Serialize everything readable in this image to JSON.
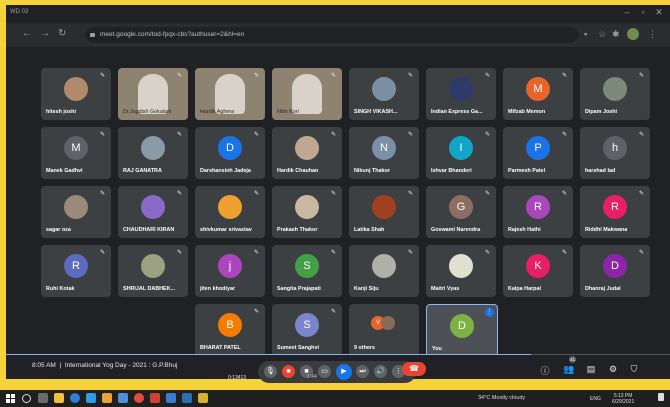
{
  "window": {
    "title": "WD 03"
  },
  "browser": {
    "url": "meet.google.com/tod-fpqx-cbs?authuser=2&hl=en"
  },
  "participants": [
    {
      "name": "hitesh joshi",
      "avatar": "photo",
      "color": "#b08a6a"
    },
    {
      "name": "Dr.Jagdish Gokalani",
      "avatar": "video"
    },
    {
      "name": "Hardik Aghera",
      "avatar": "video"
    },
    {
      "name": "Nitin Kori",
      "avatar": "video"
    },
    {
      "name": "SINGH VIKASH...",
      "avatar": "photo",
      "color": "#7a8fa0"
    },
    {
      "name": "Indian Express Ga...",
      "avatar": "photo",
      "color": "#2d3a6a"
    },
    {
      "name": "Mifzab Memon",
      "initial": "M",
      "color": "#e8642c"
    },
    {
      "name": "Dipam Joshi",
      "avatar": "photo",
      "color": "#7d8a7a"
    },
    {
      "name": "Manek Gadhvi",
      "initial": "M",
      "color": "#5f6368"
    },
    {
      "name": "RAJ GANATRA",
      "avatar": "photo",
      "color": "#8a9aa8"
    },
    {
      "name": "Darshansinh Jadeja",
      "initial": "D",
      "color": "#1a73e8"
    },
    {
      "name": "Hardik Chauhan",
      "avatar": "photo",
      "color": "#c0a890"
    },
    {
      "name": "Nikunj Thakor",
      "initial": "N",
      "color": "#7b8fa8"
    },
    {
      "name": "Ishvar Bhanderi",
      "initial": "I",
      "color": "#12a5c8"
    },
    {
      "name": "Parmesh Patel",
      "initial": "P",
      "color": "#1a73e8"
    },
    {
      "name": "harshad lad",
      "initial": "h",
      "color": "#5f6368"
    },
    {
      "name": "sagar oza",
      "avatar": "photo",
      "color": "#9a8a7a"
    },
    {
      "name": "CHAUDHARI KIRAN",
      "avatar": "photo",
      "color": "#8a6ac8"
    },
    {
      "name": "shivkumar srivastav",
      "avatar": "photo",
      "color": "#f0a030"
    },
    {
      "name": "Prakash Thakor",
      "avatar": "photo",
      "color": "#c8b8a0"
    },
    {
      "name": "Latika Shah",
      "avatar": "photo",
      "color": "#a04020"
    },
    {
      "name": "Goswami Narendra",
      "initial": "G",
      "color": "#8d6e63"
    },
    {
      "name": "Rajesh Hathi",
      "initial": "R",
      "color": "#ab47bc"
    },
    {
      "name": "Riddhi Makwana",
      "initial": "R",
      "color": "#e91e63"
    },
    {
      "name": "Ruhi Kotak",
      "initial": "R",
      "color": "#5c6bc0"
    },
    {
      "name": "SHRIJAL DABHEK...",
      "avatar": "photo",
      "color": "#9aa080"
    },
    {
      "name": "jiten khodiyar",
      "initial": "j",
      "color": "#ab47bc"
    },
    {
      "name": "Sangita Prajapati",
      "initial": "S",
      "color": "#43a047"
    },
    {
      "name": "Kanji Siju",
      "avatar": "photo",
      "color": "#b0b0a8"
    },
    {
      "name": "Maitri Vyas",
      "avatar": "photo",
      "color": "#e0e0d0"
    },
    {
      "name": "Kalpa Harpal",
      "initial": "K",
      "color": "#e91e63"
    },
    {
      "name": "Dhanraj Judal",
      "initial": "D",
      "color": "#8e24aa"
    },
    {
      "name": "BHARAT PATEL",
      "initial": "B",
      "color": "#f57c00"
    },
    {
      "name": "Sumeet Sanghvi",
      "initial": "S",
      "color": "#7986cb"
    },
    {
      "name": "9 others",
      "initial": "",
      "color": "#5f6368"
    },
    {
      "name": "You",
      "initial": "D",
      "color": "#7cb342"
    }
  ],
  "others_dots": [
    {
      "initial": "V",
      "color": "#e8642c"
    },
    {
      "initial": "",
      "color": "#8a6a5a"
    }
  ],
  "meeting": {
    "time": "8:05 AM",
    "divider": "|",
    "title": "International Yog Day - 2021 : G.P.Bhuj"
  },
  "player": {
    "elapsed": "0:13413",
    "time": "1:44",
    "progress": 0.79
  },
  "participant_count_badge": "41",
  "taskbar": {
    "weather": "34°C  Mostly cloudy",
    "lang": "ENG",
    "time": "5:13 PM",
    "date": "6/29/2021"
  }
}
